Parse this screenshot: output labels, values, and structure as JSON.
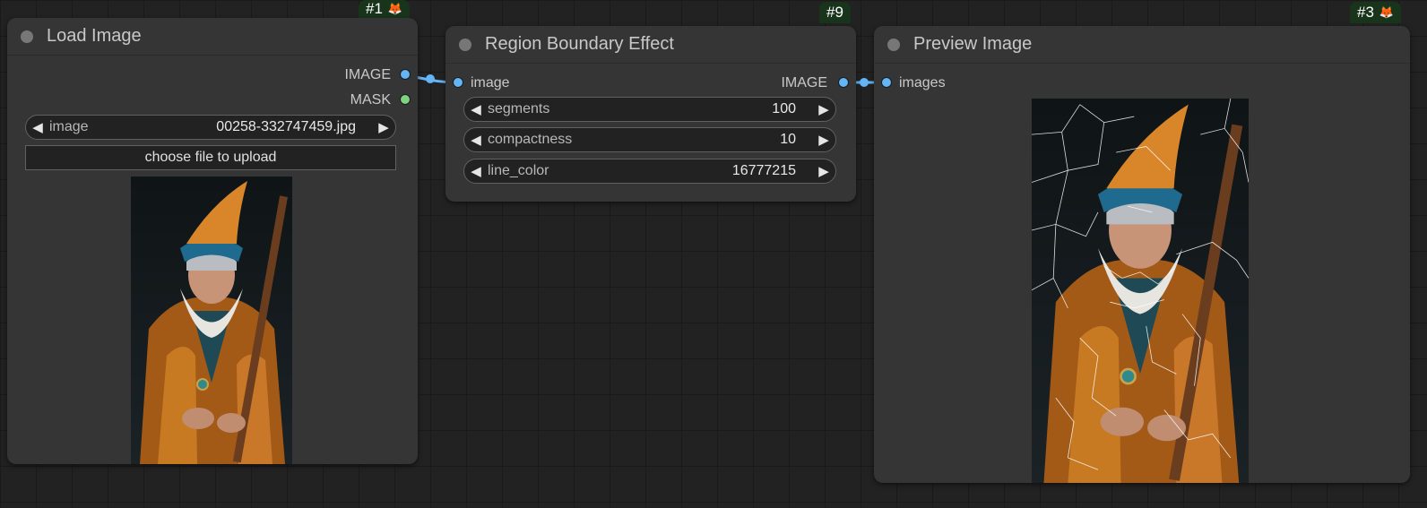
{
  "nodes": {
    "load_image": {
      "id": "#1",
      "title": "Load Image",
      "outputs": [
        "IMAGE",
        "MASK"
      ],
      "widget": {
        "name": "image",
        "value": "00258-332747459.jpg"
      },
      "upload_label": "choose file to upload"
    },
    "region_boundary": {
      "id": "#9",
      "title": "Region Boundary Effect",
      "input": "image",
      "output": "IMAGE",
      "widgets": [
        {
          "name": "segments",
          "value": "100"
        },
        {
          "name": "compactness",
          "value": "10"
        },
        {
          "name": "line_color",
          "value": "16777215"
        }
      ]
    },
    "preview_image": {
      "id": "#3",
      "title": "Preview Image",
      "input": "images"
    }
  },
  "colors": {
    "image_slot": "#64b5f6",
    "mask_slot": "#7ed17e",
    "badge_bg": "#18351c",
    "node_bg": "#353535",
    "canvas_bg": "#222222"
  },
  "icons": {
    "badge": "fox-icon",
    "widget_left": "triangle-left-icon",
    "widget_right": "triangle-right-icon"
  }
}
